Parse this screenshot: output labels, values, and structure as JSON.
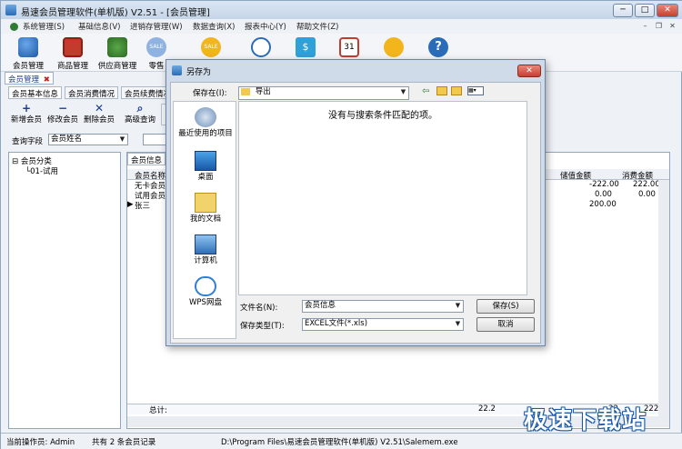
{
  "window": {
    "title": "易速会员管理软件(单机版) V2.51 - [会员管理]",
    "controls": [
      "─",
      "□",
      "✕"
    ]
  },
  "menu": [
    "系统管理(S)",
    "基础信息(V)",
    "进销存管理(W)",
    "数据查询(X)",
    "报表中心(Y)",
    "帮助文件(Z)"
  ],
  "mdi_controls": [
    "–",
    "❐",
    "✕"
  ],
  "toolbar": [
    {
      "label": "会员管理",
      "icon": "members-icon"
    },
    {
      "label": "商品管理",
      "icon": "products-icon"
    },
    {
      "label": "供应商管理",
      "icon": "supplier-icon"
    },
    {
      "label": "零售",
      "icon": "sale-icon"
    },
    {
      "label": "",
      "icon": "sale-tag-icon"
    },
    {
      "label": "",
      "icon": "search-doc-icon"
    },
    {
      "label": "",
      "icon": "money-icon"
    },
    {
      "label": "",
      "icon": "calendar-icon"
    },
    {
      "label": "",
      "icon": "support-icon"
    },
    {
      "label": "",
      "icon": "help-icon"
    }
  ],
  "doc_tab": {
    "label": "会员管理",
    "close": "✖"
  },
  "sub_tabs": [
    "会员基本信息",
    "会员消费情况",
    "会员续费情况"
  ],
  "actions": [
    {
      "glyph": "+",
      "label": "新增会员"
    },
    {
      "glyph": "−",
      "label": "修改会员"
    },
    {
      "glyph": "✕",
      "label": "删除会员"
    },
    {
      "glyph": "⌕",
      "label": "高级查询"
    }
  ],
  "query": {
    "label": "查询字段",
    "field_value": "会员姓名"
  },
  "tree": {
    "root": "会员分类",
    "child": "01-试用"
  },
  "grid": {
    "tab": "会员信息",
    "left_header": "会员名称",
    "rows": [
      "无卡会员",
      "试用会员",
      "张三"
    ],
    "right_headers": [
      "储值金额",
      "消费金额"
    ],
    "right_rows": [
      [
        "-222.00",
        "222.00"
      ],
      [
        "0.00",
        "0.00"
      ],
      [
        "200.00",
        ""
      ]
    ],
    "total_label": "总计:",
    "total_mid": "22.2",
    "total_right": [
      "-22",
      "222"
    ]
  },
  "status": {
    "operator": "当前操作员: Admin",
    "records": "共有 2 条会员记录",
    "path": "D:\\Program Files\\易速会员管理软件(单机版) V2.51\\Salemem.exe"
  },
  "dialog": {
    "title": "另存为",
    "save_in_label": "保存在(I):",
    "save_in_value": "导出",
    "empty_message": "没有与搜索条件匹配的项。",
    "places": [
      "最近使用的项目",
      "桌面",
      "我的文档",
      "计算机",
      "WPS网盘"
    ],
    "filename_label": "文件名(N):",
    "filename_value": "会员信息",
    "filetype_label": "保存类型(T):",
    "filetype_value": "EXCEL文件(*.xls)",
    "save_button": "保存(S)",
    "cancel_button": "取消"
  },
  "watermark": "极速下载站"
}
